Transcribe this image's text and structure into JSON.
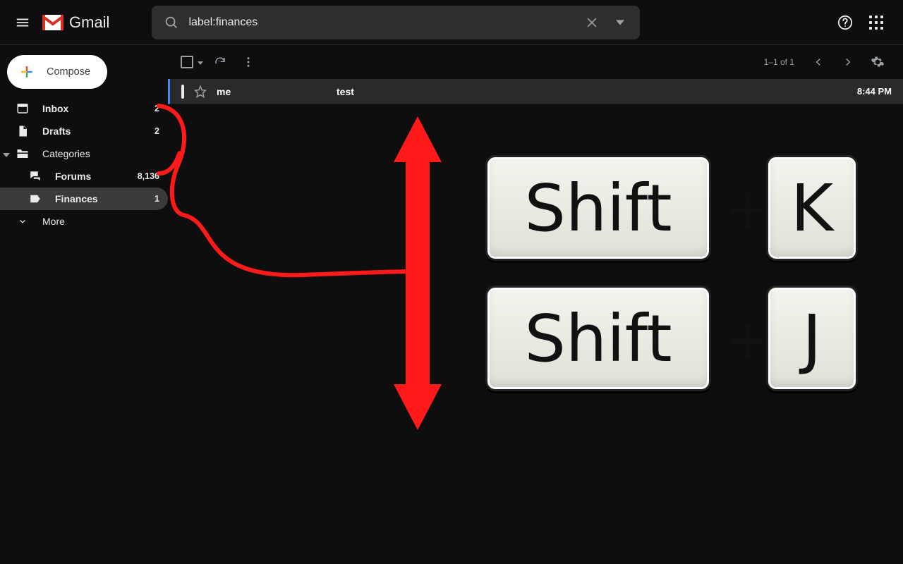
{
  "header": {
    "app_name": "Gmail",
    "search_value": "label:finances"
  },
  "compose_label": "Compose",
  "sidebar": {
    "items": [
      {
        "label": "Inbox",
        "count": "2"
      },
      {
        "label": "Drafts",
        "count": "2"
      },
      {
        "label": "Categories",
        "count": ""
      },
      {
        "label": "Forums",
        "count": "8,136"
      },
      {
        "label": "Finances",
        "count": "1"
      },
      {
        "label": "More",
        "count": ""
      }
    ]
  },
  "toolbar": {
    "page_count": "1–1 of 1"
  },
  "emails": [
    {
      "sender": "me",
      "subject": "test",
      "time": "8:44 PM"
    }
  ],
  "annotation": {
    "key_shift": "Shift",
    "key_k": "K",
    "key_j": "J",
    "plus": "+"
  }
}
